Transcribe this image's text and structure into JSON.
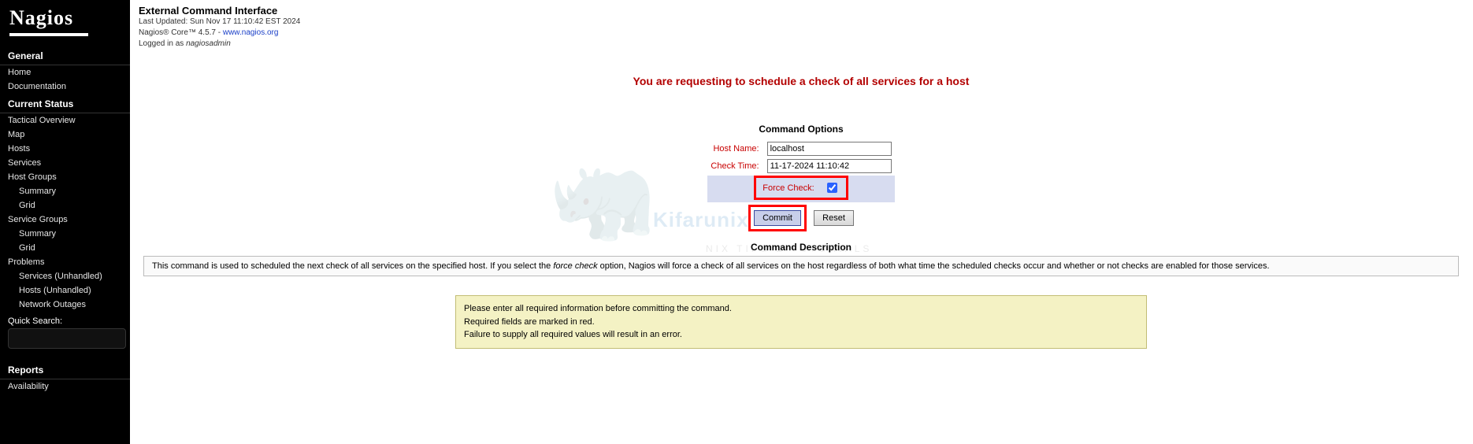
{
  "logo": "Nagios",
  "nav": {
    "general": {
      "title": "General",
      "items": [
        "Home",
        "Documentation"
      ]
    },
    "current": {
      "title": "Current Status",
      "items": [
        "Tactical Overview",
        "Map",
        "Hosts",
        "Services",
        "Host Groups"
      ],
      "hostgroups_sub": [
        "Summary",
        "Grid"
      ],
      "servicegroups_label": "Service Groups",
      "servicegroups_sub": [
        "Summary",
        "Grid"
      ],
      "problems_label": "Problems",
      "problems_sub": [
        "Services (Unhandled)",
        "Hosts (Unhandled)",
        "Network Outages"
      ]
    },
    "quicksearch_label": "Quick Search:",
    "reports": {
      "title": "Reports",
      "items": [
        "Availability"
      ]
    }
  },
  "header": {
    "title": "External Command Interface",
    "updated": "Last Updated: Sun Nov 17 11:10:42 EST 2024",
    "product": "Nagios® Core™ 4.5.7 - ",
    "product_link": "www.nagios.org",
    "logged_in_prefix": "Logged in as ",
    "logged_in_user": "nagiosadmin"
  },
  "request_heading": "You are requesting to schedule a check of all services for a host",
  "options": {
    "title": "Command Options",
    "host_label": "Host Name:",
    "host_value": "localhost",
    "time_label": "Check Time:",
    "time_value": "11-17-2024 11:10:42",
    "force_label": "Force Check:",
    "force_checked": true,
    "commit": "Commit",
    "reset": "Reset"
  },
  "description": {
    "title": "Command Description",
    "text_a": "This command is used to scheduled the next check of all services on the specified host. If you select the ",
    "text_i": "force check",
    "text_b": " option, Nagios will force a check of all services on the host regardless of both what time the scheduled checks occur and whether or not checks are enabled for those services."
  },
  "info": {
    "l1": "Please enter all required information before committing the command.",
    "l2": "Required fields are marked in red.",
    "l3": "Failure to supply all required values will result in an error."
  },
  "watermark": {
    "brand": "Kifarunix",
    "tag": "NIX TIPS & TUTORIALS"
  }
}
